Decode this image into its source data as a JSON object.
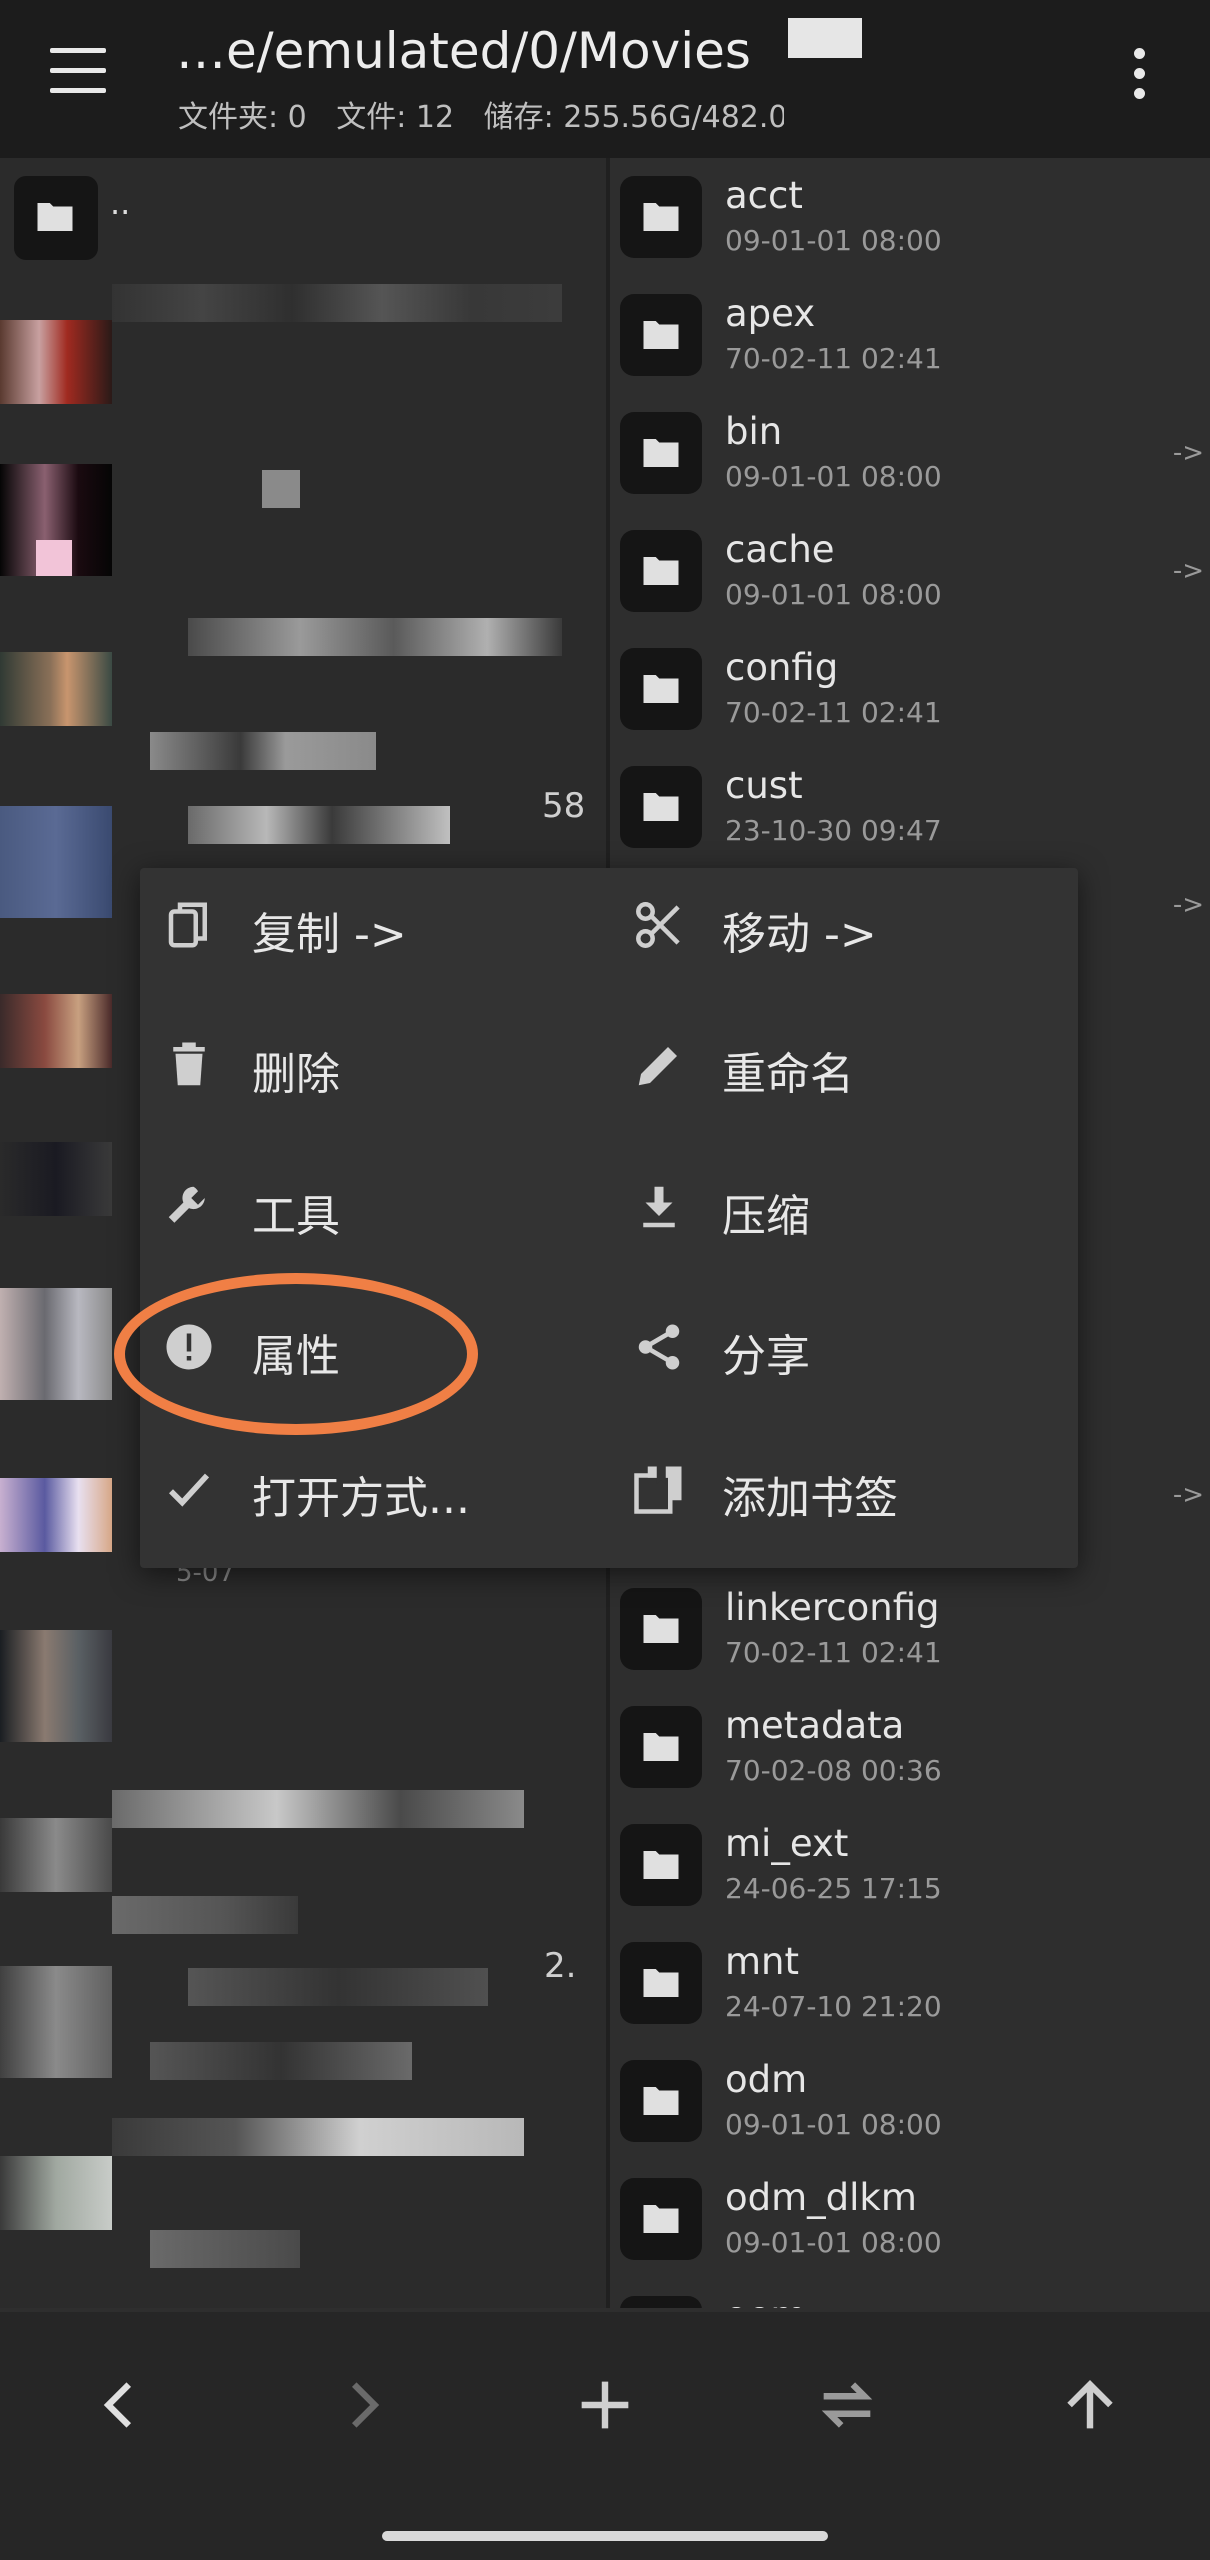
{
  "appbar": {
    "title": "…e/emulated/0/Movies",
    "stats": [
      "文件夹: 0",
      "文件: 12",
      "储存: 255.56G/482.0"
    ],
    "menu_icon": "hamburger-menu-icon",
    "more_icon": "more-vert-icon"
  },
  "left_pane": {
    "parent_label": "..",
    "snippet_1": "58",
    "snippet_2": "5-07",
    "snippet_3": "2."
  },
  "right_pane": {
    "files": [
      {
        "name": "acct",
        "date": "09-01-01 08:00",
        "arrow": ""
      },
      {
        "name": "apex",
        "date": "70-02-11 02:41",
        "arrow": ""
      },
      {
        "name": "bin",
        "date": "09-01-01 08:00",
        "arrow": "->"
      },
      {
        "name": "cache",
        "date": "09-01-01 08:00",
        "arrow": "->"
      },
      {
        "name": "config",
        "date": "70-02-11 02:41",
        "arrow": ""
      },
      {
        "name": "cust",
        "date": "23-10-30 09:47",
        "arrow": ""
      },
      {
        "name": "linkerconfig",
        "date": "70-02-11 02:41",
        "arrow": ""
      },
      {
        "name": "metadata",
        "date": "70-02-08 00:36",
        "arrow": ""
      },
      {
        "name": "mi_ext",
        "date": "24-06-25 17:15",
        "arrow": ""
      },
      {
        "name": "mnt",
        "date": "24-07-10 21:20",
        "arrow": ""
      },
      {
        "name": "odm",
        "date": "09-01-01 08:00",
        "arrow": ""
      },
      {
        "name": "odm_dlkm",
        "date": "09-01-01 08:00",
        "arrow": ""
      },
      {
        "name": "oem",
        "date": "",
        "arrow": ""
      }
    ],
    "side_arrows": [
      "->",
      "->"
    ]
  },
  "context_menu": {
    "items": [
      {
        "label": "复制 ->",
        "icon": "copy-icon"
      },
      {
        "label": "移动 ->",
        "icon": "scissors-icon"
      },
      {
        "label": "删除",
        "icon": "trash-icon"
      },
      {
        "label": "重命名",
        "icon": "pencil-icon"
      },
      {
        "label": "工具",
        "icon": "wrench-icon"
      },
      {
        "label": "压缩",
        "icon": "download-icon"
      },
      {
        "label": "属性",
        "icon": "info-exclamation-icon"
      },
      {
        "label": "分享",
        "icon": "share-icon"
      },
      {
        "label": "打开方式...",
        "icon": "check-icon"
      },
      {
        "label": "添加书签",
        "icon": "bookmark-icon"
      }
    ],
    "highlighted": "属性",
    "highlight_color": "#f07f45"
  },
  "bottombar": {
    "buttons": [
      "back-chevron-icon",
      "forward-chevron-icon",
      "plus-icon",
      "swap-icon",
      "up-arrow-icon"
    ]
  },
  "colors": {
    "appbar_bg": "#1c1c1c",
    "pane_bg": "#2e2e2e",
    "menu_bg": "#333333",
    "accent": "#f07f45"
  }
}
